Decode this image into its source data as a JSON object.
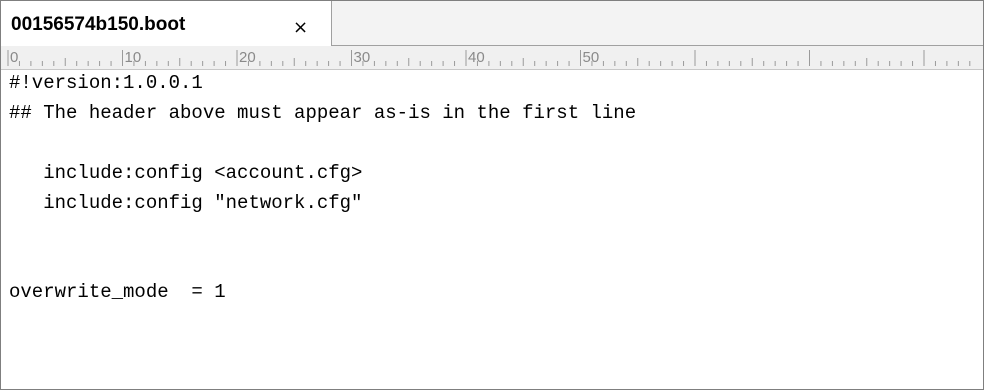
{
  "tab": {
    "filename": "00156574b150.boot",
    "close_glyph": "×"
  },
  "ruler": {
    "labels": [
      "0",
      "10",
      "20",
      "30",
      "40",
      "50"
    ]
  },
  "editor": {
    "lines": [
      "#!version:1.0.0.1",
      "## The header above must appear as-is in the first line",
      "",
      "   include:config <account.cfg>",
      "   include:config \"network.cfg\"",
      "",
      "",
      "overwrite_mode  = 1"
    ]
  }
}
